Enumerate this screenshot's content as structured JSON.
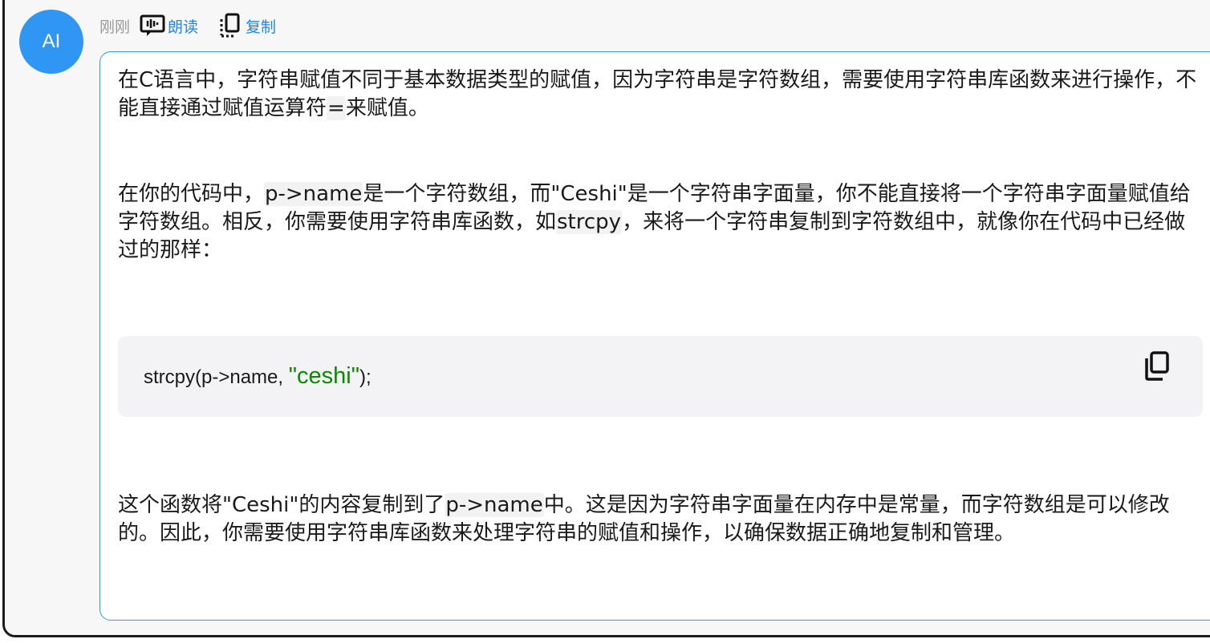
{
  "message": {
    "avatar_label": "AI",
    "time": "刚刚",
    "actions": {
      "read_label": "朗读",
      "copy_label": "复制"
    },
    "paragraph1": {
      "t1": "在C语言中，字符串赋值不同于基本数据类型的赋值，因为字符串是字符数组，需要使用字符串库函数来进行操作，不能直接通过赋值运算符",
      "code1": "=",
      "t2": "来赋值。"
    },
    "paragraph2": {
      "t1": "在你的代码中，",
      "code1": "p->name",
      "t2": "是一个字符数组，而\"Ceshi\"是一个字符串字面量，你不能直接将一个字符串字面量赋值给字符数组。相反，你需要使用字符串库函数，如",
      "code2": "strcpy",
      "t3": "，来将一个字符串复制到字符数组中，就像你在代码中已经做过的那样："
    },
    "code_block": {
      "prefix": "strcpy(p->name, ",
      "string": "\"ceshi\"",
      "suffix": ");"
    },
    "paragraph3": {
      "t1": "这个函数将\"Ceshi\"的内容复制到了",
      "code1": "p->name",
      "t2": "中。这是因为字符串字面量在内存中是常量，而字符数组是可以修改的。因此，你需要使用字符串库函数来处理字符串的赋值和操作，以确保数据正确地复制和管理。"
    }
  },
  "colors": {
    "accent": "#2f97f3",
    "link": "#1d86e8",
    "code_string": "#098a00",
    "frame_border": "#1c1c1c"
  },
  "icons": {
    "read": "speaker-waveform-icon",
    "copy": "copy-icon",
    "code_copy": "copy-icon"
  }
}
